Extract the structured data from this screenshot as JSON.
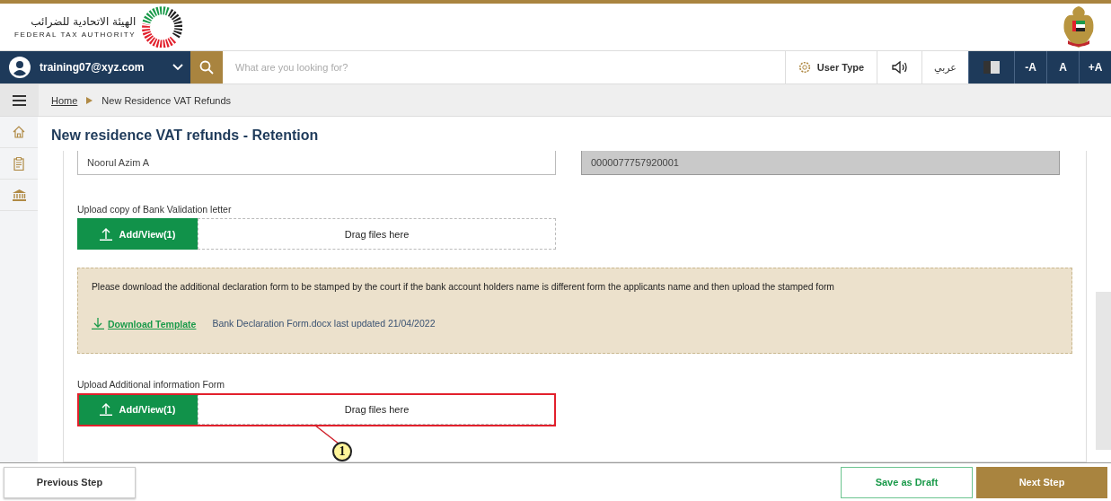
{
  "header": {
    "logo_arabic": "الهيئة الاتحادية للضرائب",
    "logo_english": "FEDERAL TAX AUTHORITY"
  },
  "nav": {
    "user": "training07@xyz.com",
    "search_placeholder": "What are you looking for?",
    "user_type": "User Type",
    "language": "عربي",
    "font_buttons": [
      "-A",
      "A",
      "+A"
    ]
  },
  "breadcrumb": [
    {
      "label": "Home",
      "kind": "link"
    },
    {
      "label": "New Residence VAT Refunds",
      "kind": "current"
    }
  ],
  "page_title": "New residence VAT refunds - Retention",
  "fields": [
    {
      "value": "Noorul Azim A",
      "disabled": false
    },
    {
      "value": "0000077757920001",
      "disabled": true
    }
  ],
  "uploads": [
    {
      "label": "Upload copy of Bank Validation letter",
      "button": "Add/View(1)",
      "drop": "Drag files here",
      "highlighted": false
    },
    {
      "label": "Upload Additional information Form",
      "button": "Add/View(1)",
      "drop": "Drag files here",
      "highlighted": true
    }
  ],
  "notice": {
    "text": "Please download the additional declaration form to be stamped by the court if the bank account holders name is different form the applicants name and then upload the stamped form",
    "link": "Download Template",
    "file_info": "Bank Declaration Form.docx last updated 21/04/2022"
  },
  "callout": "1",
  "footer": {
    "previous": "Previous Step",
    "save": "Save as Draft",
    "next": "Next Step"
  }
}
